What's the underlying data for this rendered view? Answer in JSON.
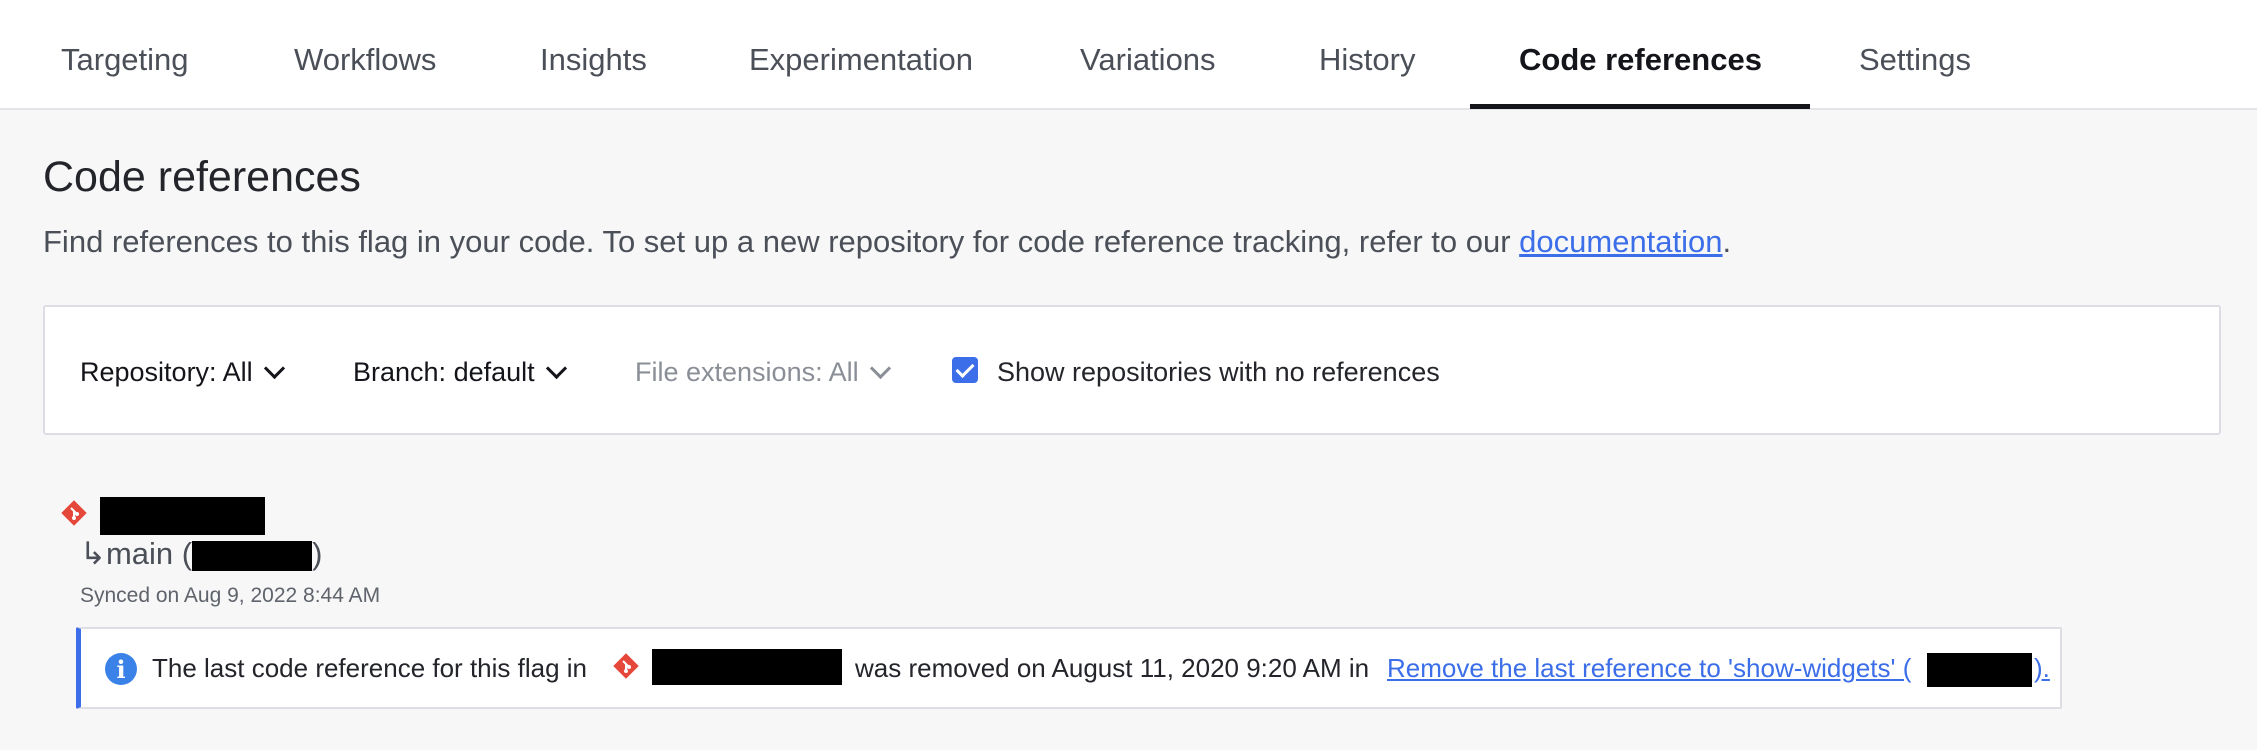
{
  "tabs": [
    {
      "label": "Targeting"
    },
    {
      "label": "Workflows"
    },
    {
      "label": "Insights"
    },
    {
      "label": "Experimentation"
    },
    {
      "label": "Variations"
    },
    {
      "label": "History"
    },
    {
      "label": "Code references",
      "active": true
    },
    {
      "label": "Settings"
    }
  ],
  "page": {
    "title": "Code references",
    "subtitle": "Find references to this flag in your code. To set up a new repository for code reference tracking, refer to our",
    "subtitle_link": "documentation",
    "subtitle_end": "."
  },
  "filters": {
    "repository": {
      "label": "Repository:",
      "value": "All"
    },
    "branch": {
      "label": "Branch:",
      "value": "default"
    },
    "file_extensions": {
      "label": "File extensions:",
      "value": "All"
    },
    "show_empty": {
      "label": "Show repositories with no references",
      "checked": true
    }
  },
  "repo": {
    "branch_prefix": "↳main (",
    "branch_suffix": ")",
    "synced": "Synced on Aug 9, 2022 8:44 AM"
  },
  "notice": {
    "prefix": "The last code reference for this flag in",
    "middle": "was removed on August 11, 2020 9:20 AM in",
    "link": "Remove the last reference to 'show-widgets' (",
    "link_end": ")."
  },
  "colors": {
    "accent": "#3b6ee8",
    "git": "#e5483a",
    "redaction": "#000000"
  }
}
